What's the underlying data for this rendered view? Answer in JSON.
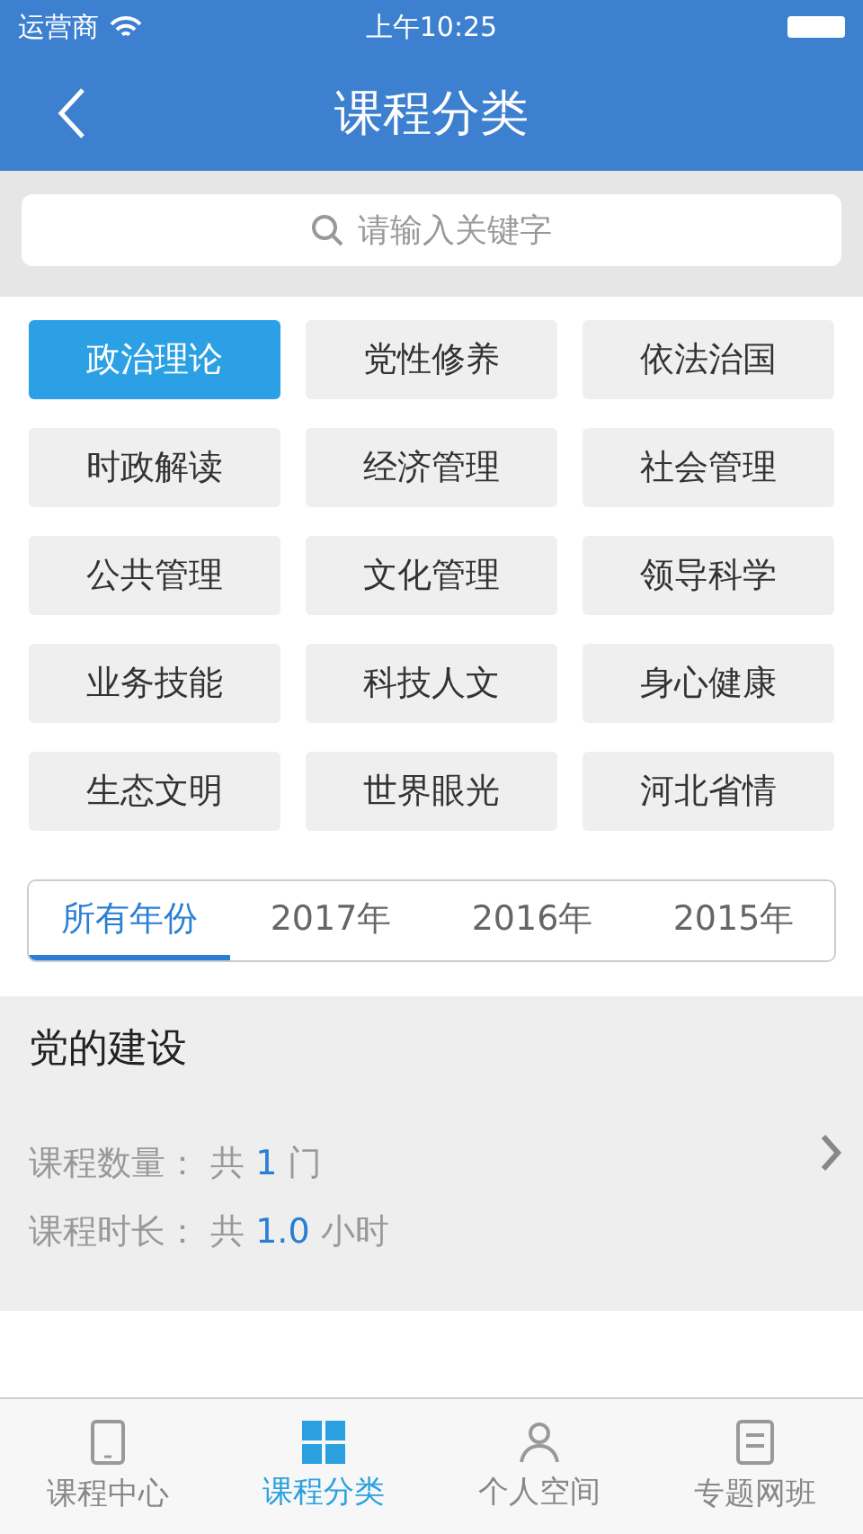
{
  "status_bar": {
    "carrier": "运营商",
    "time": "上午10:25"
  },
  "nav": {
    "title": "课程分类"
  },
  "search": {
    "placeholder": "请输入关键字"
  },
  "categories": [
    {
      "label": "政治理论",
      "selected": true
    },
    {
      "label": "党性修养",
      "selected": false
    },
    {
      "label": "依法治国",
      "selected": false
    },
    {
      "label": "时政解读",
      "selected": false
    },
    {
      "label": "经济管理",
      "selected": false
    },
    {
      "label": "社会管理",
      "selected": false
    },
    {
      "label": "公共管理",
      "selected": false
    },
    {
      "label": "文化管理",
      "selected": false
    },
    {
      "label": "领导科学",
      "selected": false
    },
    {
      "label": "业务技能",
      "selected": false
    },
    {
      "label": "科技人文",
      "selected": false
    },
    {
      "label": "身心健康",
      "selected": false
    },
    {
      "label": "生态文明",
      "selected": false
    },
    {
      "label": "世界眼光",
      "selected": false
    },
    {
      "label": "河北省情",
      "selected": false
    }
  ],
  "years": [
    {
      "label": "所有年份",
      "selected": true
    },
    {
      "label": "2017年",
      "selected": false
    },
    {
      "label": "2016年",
      "selected": false
    },
    {
      "label": "2015年",
      "selected": false
    }
  ],
  "course": {
    "title": "党的建设",
    "count_label": "课程数量：",
    "count_prefix": "共",
    "count": "1",
    "count_unit": "门",
    "duration_label": "课程时长：",
    "duration_prefix": "共",
    "duration": "1.0",
    "duration_unit": "小时"
  },
  "tab_bar": [
    {
      "label": "课程中心",
      "selected": false
    },
    {
      "label": "课程分类",
      "selected": true
    },
    {
      "label": "个人空间",
      "selected": false
    },
    {
      "label": "专题网班",
      "selected": false
    }
  ]
}
